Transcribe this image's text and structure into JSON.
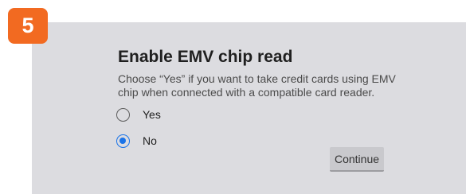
{
  "step_badge": "5",
  "dialog": {
    "title": "Enable EMV chip read",
    "description": "Choose “Yes” if you want to take credit cards using EMV chip when connected with a compatible card reader.",
    "options": [
      {
        "label": "Yes",
        "selected": false
      },
      {
        "label": "No",
        "selected": true
      }
    ],
    "continue_label": "Continue"
  },
  "colors": {
    "badge": "#f26a21",
    "panel": "#dcdce0",
    "accent": "#1a73e8",
    "button": "#c9c9cd"
  }
}
